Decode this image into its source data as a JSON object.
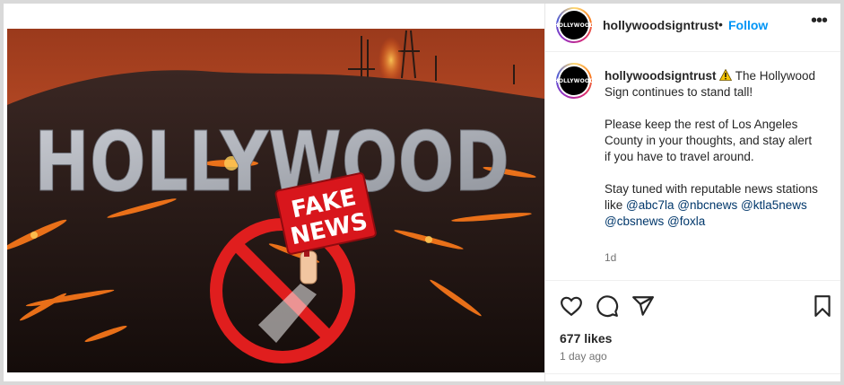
{
  "header": {
    "username": "hollywoodsigntrust",
    "separator": "•",
    "follow_label": "Follow",
    "more_label": "•••"
  },
  "avatar": {
    "text": "HOLLYWOOD"
  },
  "media": {
    "sign_text": "HOLLYWOOD",
    "badge_line1": "FAKE",
    "badge_line2": "NEWS"
  },
  "caption": {
    "username": "hollywoodsigntrust",
    "line1": " The Hollywood Sign continues to stand tall!",
    "para2": "Please keep the rest of Los Angeles County in your thoughts, and stay alert if you have to travel around.",
    "para3_prefix": "Stay tuned with reputable news stations like ",
    "mentions": [
      "@abc7la",
      "@nbcnews",
      "@ktla5news",
      "@cbsnews",
      "@foxla"
    ],
    "time": "1d"
  },
  "actions": {
    "icons": [
      "heart-icon",
      "comment-icon",
      "share-icon",
      "bookmark-icon"
    ]
  },
  "footer": {
    "likes": "677 likes",
    "posted_ago": "1 day ago"
  },
  "colors": {
    "accent": "#0095f6",
    "mention": "#00376b",
    "stop_red": "#e01e1e",
    "badge_red": "#d8161c"
  }
}
